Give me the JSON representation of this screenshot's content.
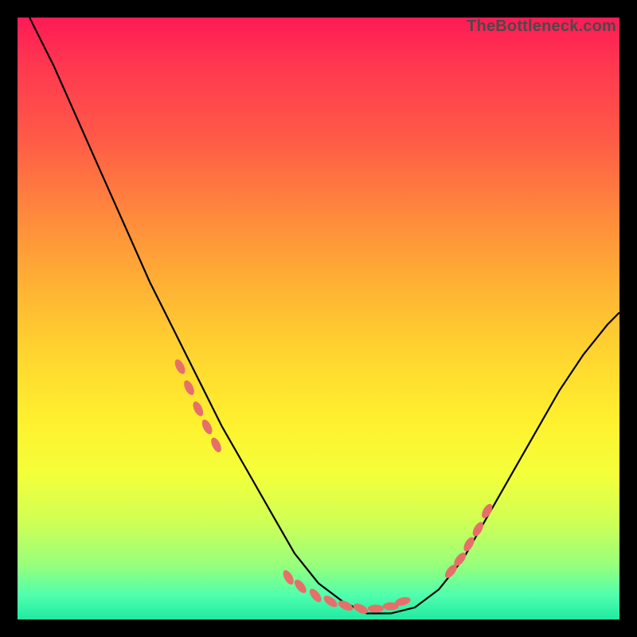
{
  "watermark": "TheBottleneck.com",
  "colors": {
    "background": "#000000",
    "curve": "#000000",
    "marker": "#e76f6a",
    "gradient_top": "#ff1a55",
    "gradient_bottom": "#20e9a2"
  },
  "chart_data": {
    "type": "line",
    "title": "",
    "xlabel": "",
    "ylabel": "",
    "xlim": [
      0,
      100
    ],
    "ylim": [
      0,
      100
    ],
    "annotations": [
      "TheBottleneck.com"
    ],
    "series": [
      {
        "name": "bottleneck-curve",
        "x": [
          2,
          6,
          10,
          14,
          18,
          22,
          26,
          30,
          34,
          38,
          42,
          46,
          50,
          54,
          58,
          62,
          66,
          70,
          74,
          78,
          82,
          86,
          90,
          94,
          98,
          100
        ],
        "y": [
          100,
          92,
          83,
          74,
          65,
          56,
          48,
          40,
          32,
          25,
          18,
          11,
          6,
          3,
          1,
          1,
          2,
          5,
          10,
          17,
          24,
          31,
          38,
          44,
          49,
          51
        ]
      }
    ],
    "markers": {
      "name": "highlight-points",
      "x": [
        27,
        28.5,
        30,
        31.5,
        33,
        45,
        47,
        49.5,
        52,
        54.5,
        57,
        59.5,
        62,
        64,
        72,
        73.5,
        75,
        76.5,
        78
      ],
      "y": [
        42,
        38.5,
        35,
        32,
        29,
        7,
        5.5,
        4,
        3,
        2.3,
        1.8,
        1.8,
        2.2,
        3,
        8,
        10,
        12.5,
        15,
        18
      ]
    }
  }
}
